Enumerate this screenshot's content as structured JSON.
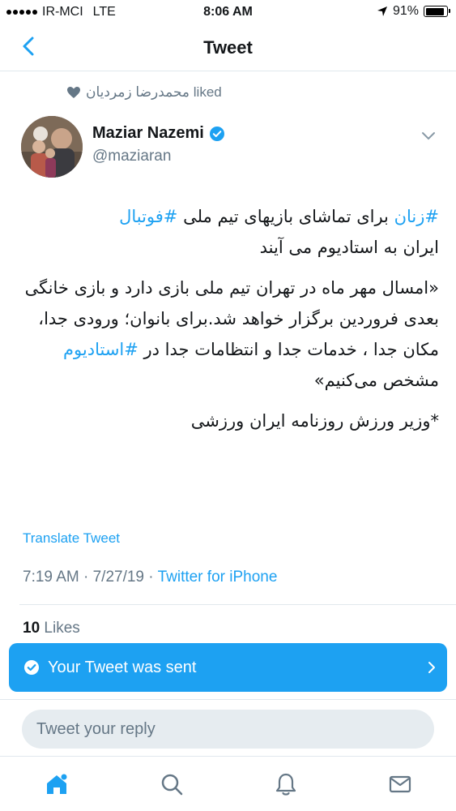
{
  "status": {
    "carrier": "IR-MCI",
    "network": "LTE",
    "time": "8:06 AM",
    "battery": "91%",
    "battery_level": 0.91
  },
  "nav": {
    "title": "Tweet",
    "back_icon": "chevron-left-icon"
  },
  "context": {
    "liked_text": "محمدرضا زمردیان liked"
  },
  "tweet": {
    "author_name": "Maziar Nazemi",
    "handle": "@maziaran",
    "line1": {
      "tag_women": "#زنان",
      "text_mid": " برای تماشای بازیهای تیم ملی ",
      "tag_football": "#فوتبال"
    },
    "line2": "ایران به استادیوم می آیند",
    "quote_before": "«امسال مهر ماه در تهران تیم ملی بازی دارد و بازی خانگی بعدی فروردین برگزار خواهد شد.برای بانوان؛ ورودی جدا، مکان جدا ، خدمات جدا و انتظامات جدا در ",
    "tag_stadium": "#استادیوم",
    "quote_after": " مشخص می‌کنیم»",
    "footer_line": "*وزیر ورزش روزنامه ایران ورزشی",
    "translate_label": "Translate Tweet",
    "time": "7:19 AM",
    "separator": "·",
    "date": "7/27/19",
    "source": "Twitter for iPhone",
    "likes_count": "10",
    "likes_label": "Likes"
  },
  "toast": {
    "message": "Your Tweet was sent"
  },
  "reply": {
    "placeholder": "Tweet your reply"
  },
  "tabs": [
    {
      "icon": "home-icon"
    },
    {
      "icon": "search-icon"
    },
    {
      "icon": "notifications-icon"
    },
    {
      "icon": "messages-icon"
    }
  ],
  "colors": {
    "accent": "#1da1f2",
    "secondary_text": "#657786",
    "primary_text": "#14171a"
  }
}
